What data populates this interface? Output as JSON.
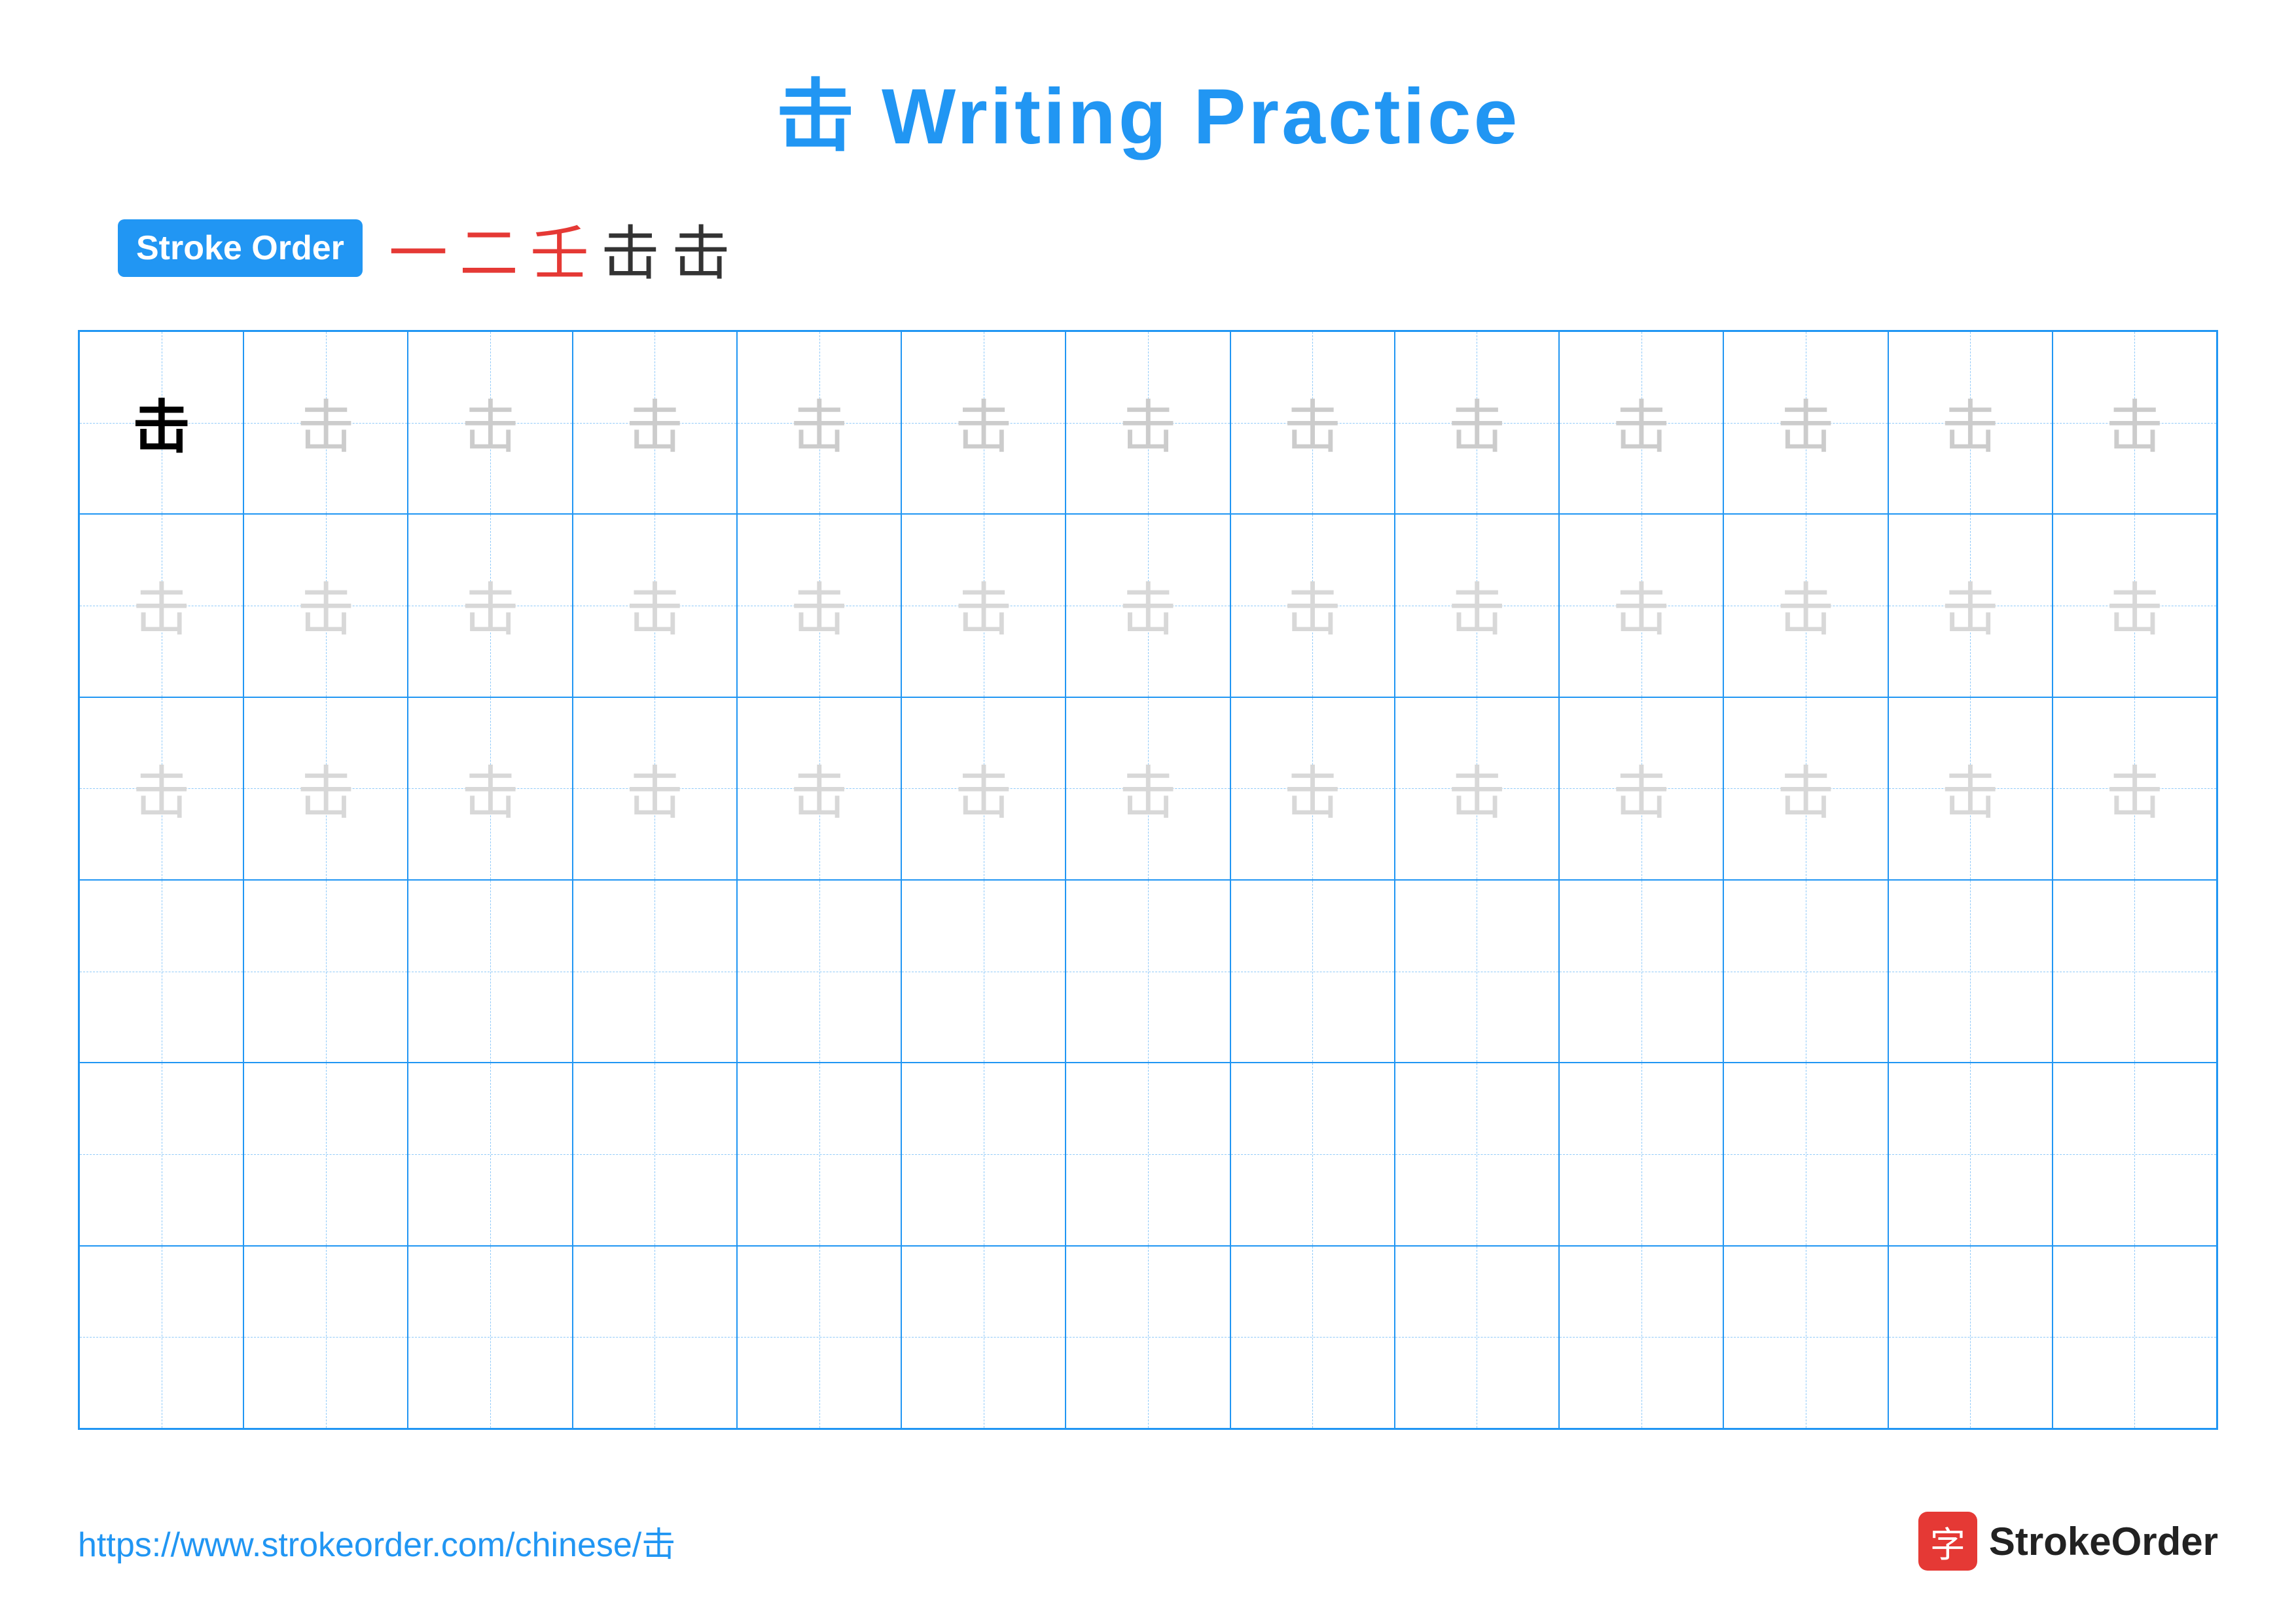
{
  "title": "击 Writing Practice",
  "stroke_order": {
    "badge_label": "Stroke Order",
    "strokes": [
      "一",
      "二",
      "壬",
      "击",
      "击"
    ]
  },
  "grid": {
    "rows": 6,
    "cols": 13,
    "character": "击",
    "guide_rows_with_chars": [
      0,
      1,
      2
    ],
    "first_cell_dark": true
  },
  "footer": {
    "url": "https://www.strokeorder.com/chinese/击",
    "logo_char": "字",
    "logo_text": "StrokeOrder"
  }
}
